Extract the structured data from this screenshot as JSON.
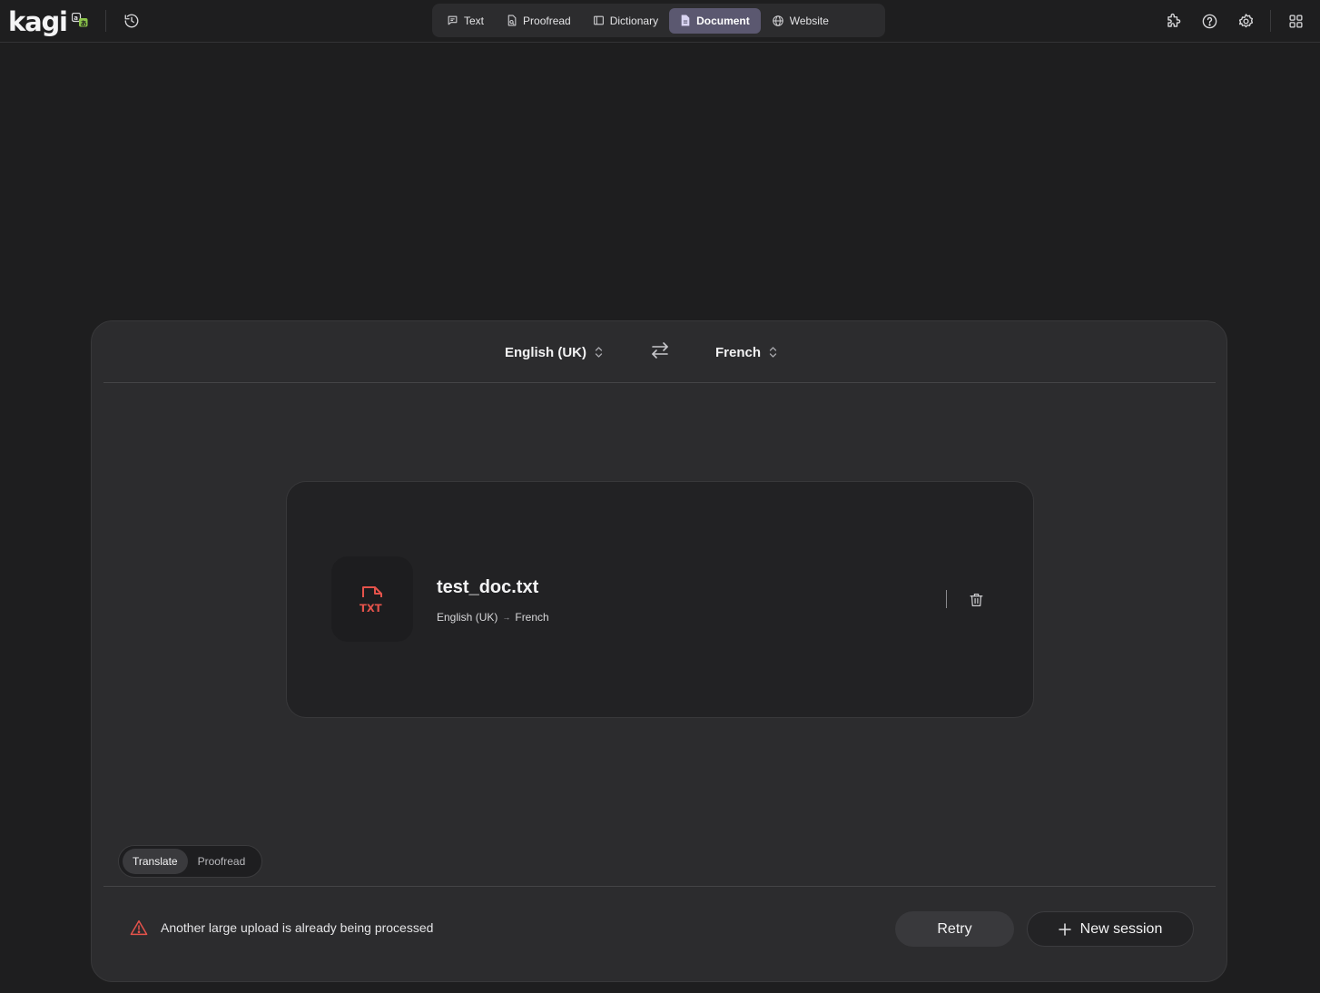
{
  "app": {
    "logo_text": "kagi",
    "logo_badge_icon": "translate-badge-icon"
  },
  "header": {
    "tabs": [
      {
        "label": "Text",
        "icon": "chat-bubble-icon",
        "active": false
      },
      {
        "label": "Proofread",
        "icon": "proofread-doc-icon",
        "active": false
      },
      {
        "label": "Dictionary",
        "icon": "book-icon",
        "active": false
      },
      {
        "label": "Document",
        "icon": "document-icon",
        "active": true
      },
      {
        "label": "Website",
        "icon": "globe-icon",
        "active": false
      }
    ],
    "right_icons": [
      "puzzle-icon",
      "help-icon",
      "gear-icon",
      "apps-grid-icon"
    ]
  },
  "languages": {
    "source": "English (UK)",
    "target": "French"
  },
  "file": {
    "name": "test_doc.txt",
    "type_label": "TXT",
    "source_lang": "English (UK)",
    "arrow": "→",
    "target_lang": "French"
  },
  "mode_toggle": {
    "options": [
      "Translate",
      "Proofread"
    ],
    "active": "Translate"
  },
  "status": {
    "error_message": "Another large upload is already being processed"
  },
  "actions": {
    "retry_label": "Retry",
    "new_session_label": "New session"
  },
  "colors": {
    "accent_active_tab": "#5b5870",
    "file_icon_red": "#e5534b",
    "warning_red": "#e5534b",
    "logo_badge_green": "#8bc34a"
  }
}
